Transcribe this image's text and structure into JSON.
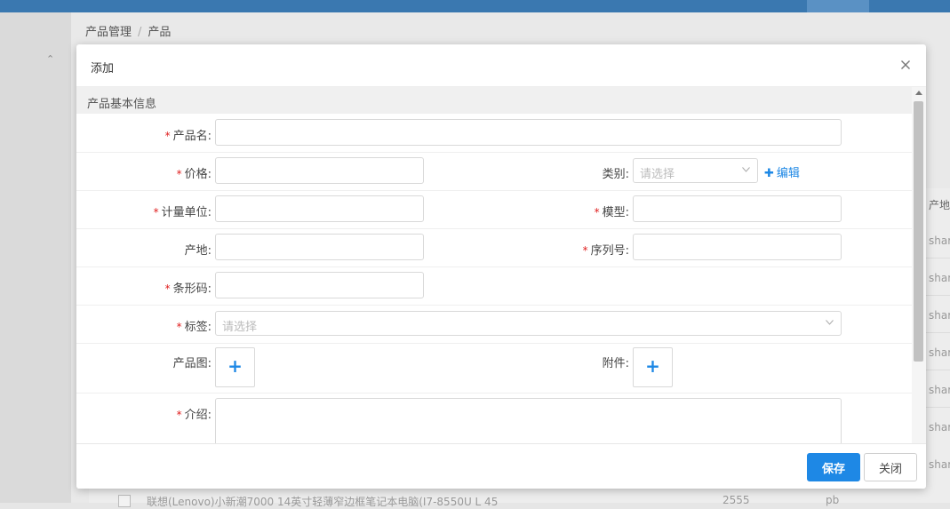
{
  "background": {
    "breadcrumb": [
      "产品管理",
      "产品"
    ],
    "breadcrumb_separator": "/",
    "table_header_partial": "产地",
    "table_cells_partial": [
      "shar",
      "shar",
      "shar",
      "shar",
      "shar",
      "shar",
      "shar"
    ],
    "bottom_row": {
      "name": "联想(Lenovo)小新潮7000 14英寸轻薄窄边框笔记本电脑(I7-8550U L 45",
      "value": "2555",
      "unit": "pb"
    }
  },
  "modal": {
    "title": "添加",
    "section_title": "产品基本信息",
    "fields": {
      "product_name": {
        "label": "产品名:",
        "value": ""
      },
      "price": {
        "label": "价格:",
        "value": ""
      },
      "category": {
        "label": "类别:",
        "placeholder": "请选择"
      },
      "category_edit": "编辑",
      "unit": {
        "label": "计量单位:",
        "value": ""
      },
      "model": {
        "label": "模型:",
        "value": ""
      },
      "origin": {
        "label": "产地:",
        "value": ""
      },
      "serial": {
        "label": "序列号:",
        "value": ""
      },
      "barcode": {
        "label": "条形码:",
        "value": ""
      },
      "tags": {
        "label": "标签:",
        "placeholder": "请选择"
      },
      "image": {
        "label": "产品图:"
      },
      "attachment": {
        "label": "附件:"
      },
      "intro": {
        "label": "介绍:",
        "value": ""
      }
    },
    "required_mark": "*",
    "save_label": "保存",
    "close_label": "关闭"
  },
  "colors": {
    "primary": "#1e88e5",
    "required": "#e02020",
    "topbar": "#3a78b0"
  }
}
